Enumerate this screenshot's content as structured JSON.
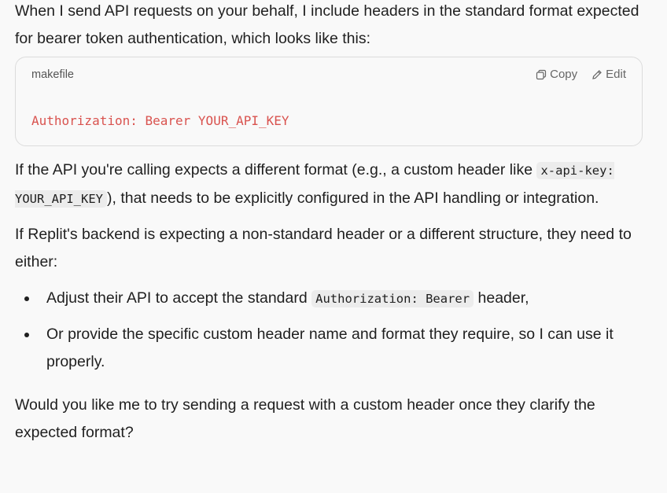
{
  "intro": {
    "line": "When I send API requests on your behalf, I include headers in the standard format expected for bearer token authentication, which looks like this:"
  },
  "code_block": {
    "language": "makefile",
    "copy_label": "Copy",
    "edit_label": "Edit",
    "code": "Authorization: Bearer YOUR_API_KEY",
    "code_color": "#d9534f"
  },
  "paragraph2": {
    "before": "If the API you're calling expects a different format (e.g., a custom header like ",
    "code": "x-api-key: YOUR_API_KEY",
    "after": "), that needs to be explicitly configured in the API handling or integration."
  },
  "paragraph3": {
    "text": "If Replit's backend is expecting a non-standard header or a different structure, they need to either:"
  },
  "bullets": {
    "item1_before": "Adjust their API to accept the standard ",
    "item1_code": "Authorization: Bearer",
    "item1_after": " header,",
    "item2": "Or provide the specific custom header name and format they require, so I can use it properly."
  },
  "closing": {
    "text": "Would you like me to try sending a request with a custom header once they clarify the expected format?"
  }
}
